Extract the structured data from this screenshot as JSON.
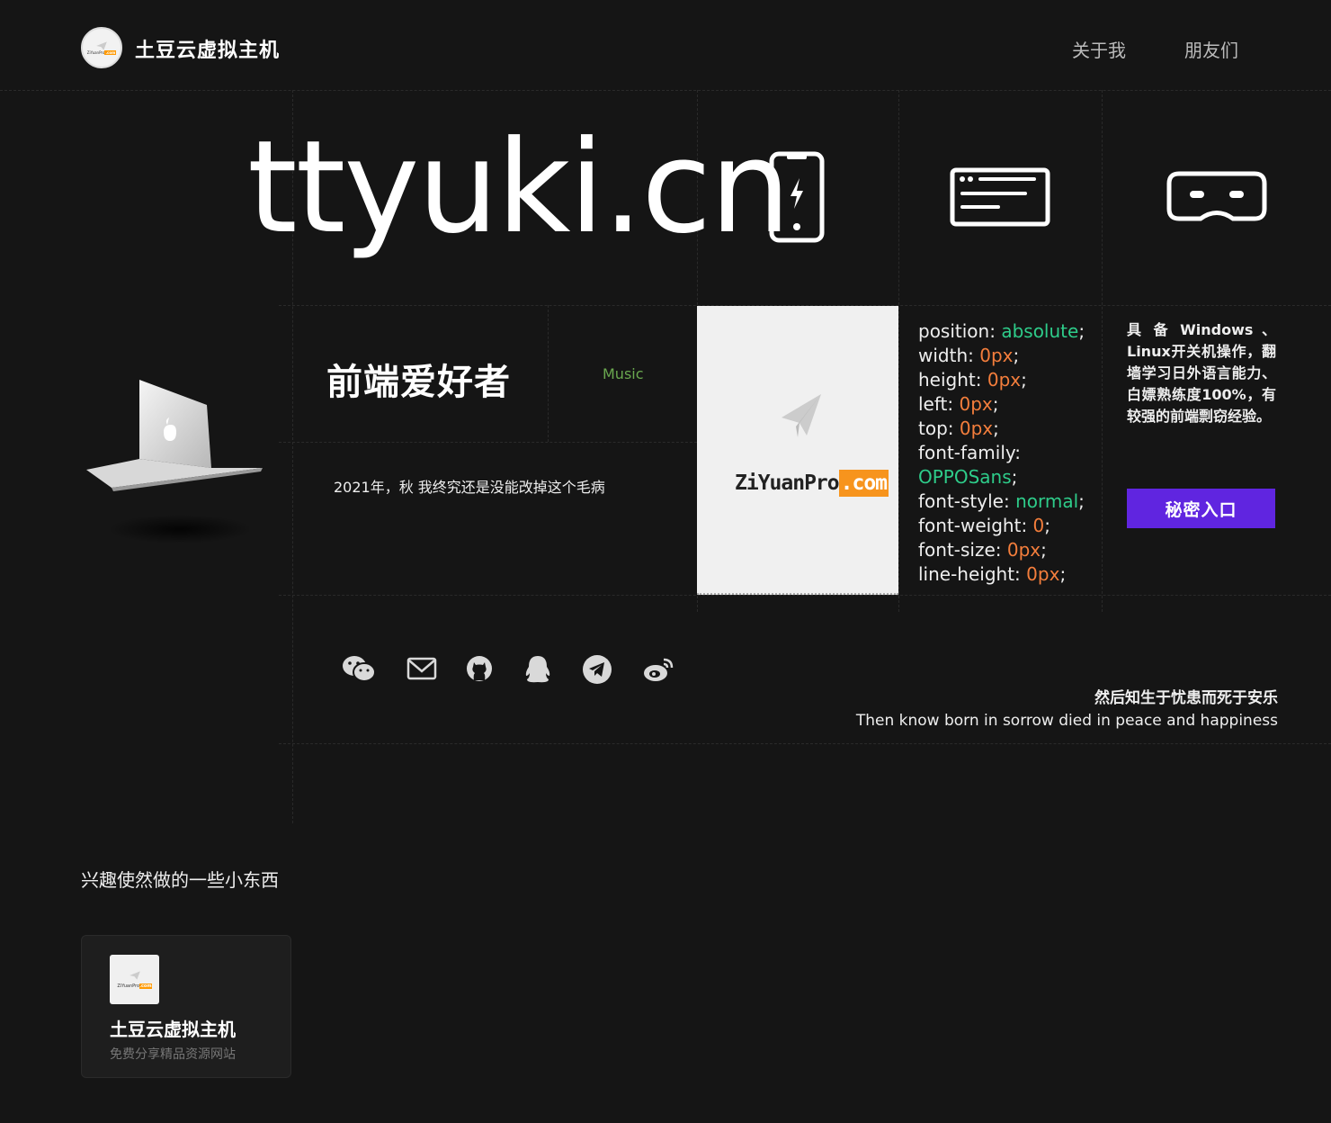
{
  "header": {
    "site_title": "土豆云虚拟主机",
    "logo_text": "ZiYuanPro",
    "logo_suffix": ".com",
    "nav": [
      {
        "label": "关于我"
      },
      {
        "label": "朋友们"
      }
    ]
  },
  "hero": {
    "domain": "ttyuki.cn",
    "icons": [
      "phone-bolt-icon",
      "terminal-window-icon",
      "vr-headset-icon"
    ]
  },
  "about": {
    "tagline": "前端爱好者",
    "music_link": "Music",
    "story": "2021年，秋 我终究还是没能改掉这个毛病",
    "laptop_icon": "laptop-icon"
  },
  "brand_card": {
    "brand": "ZiYuanPro",
    "brand_suffix": ".com"
  },
  "code": {
    "lines": [
      {
        "prop": "position:",
        "val": "absolute",
        "type": "g"
      },
      {
        "prop": "width:",
        "val": "0px",
        "type": "o"
      },
      {
        "prop": "height:",
        "val": "0px",
        "type": "o"
      },
      {
        "prop": "left:",
        "val": "0px",
        "type": "o"
      },
      {
        "prop": "top:",
        "val": "0px",
        "type": "o"
      },
      {
        "prop": "font-family:",
        "val": "",
        "type": ""
      },
      {
        "prop": "",
        "val": "OPPOSans",
        "type": "g"
      },
      {
        "prop": "font-style:",
        "val": "normal",
        "type": "g"
      },
      {
        "prop": "font-weight:",
        "val": "0",
        "type": "o"
      },
      {
        "prop": "font-size:",
        "val": "0px",
        "type": "o"
      },
      {
        "prop": "line-height:",
        "val": "0px",
        "type": "o"
      }
    ]
  },
  "skills": {
    "text": "具 备 Windows 、Linux开关机操作，翻墙学习日外语言能力、白嫖熟练度100%，有较强的前端剽窃经验。",
    "secret_button": "秘密入口"
  },
  "social": {
    "icons": [
      "wechat-icon",
      "mail-icon",
      "github-icon",
      "qq-icon",
      "telegram-icon",
      "weibo-icon"
    ]
  },
  "quote": {
    "cn": "然后知生于忧患而死于安乐",
    "en": "Then know born in sorrow died in peace and happiness"
  },
  "projects": {
    "section_title": "兴趣使然做的一些小东西",
    "items": [
      {
        "name": "土豆云虚拟主机",
        "desc": "免费分享精品资源网站",
        "thumb_text": "ZiYuanPro",
        "thumb_suffix": ".com"
      }
    ]
  }
}
